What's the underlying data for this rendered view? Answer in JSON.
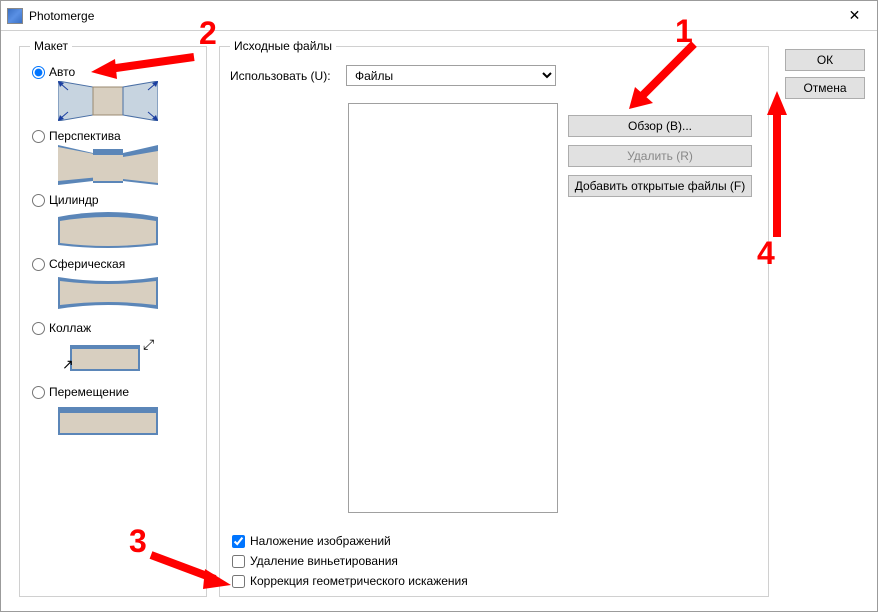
{
  "window": {
    "title": "Photomerge"
  },
  "layout": {
    "legend": "Макет",
    "options": [
      {
        "label": "Авто",
        "selected": true
      },
      {
        "label": "Перспектива",
        "selected": false
      },
      {
        "label": "Цилиндр",
        "selected": false
      },
      {
        "label": "Сферическая",
        "selected": false
      },
      {
        "label": "Коллаж",
        "selected": false
      },
      {
        "label": "Перемещение",
        "selected": false
      }
    ]
  },
  "source": {
    "legend": "Исходные файлы",
    "useLabel": "Использовать (U):",
    "useValue": "Файлы",
    "browse": "Обзор (B)...",
    "remove": "Удалить (R)",
    "addOpen": "Добавить открытые файлы (F)"
  },
  "checks": {
    "blend": {
      "label": "Наложение изображений",
      "checked": true
    },
    "vignette": {
      "label": "Удаление виньетирования",
      "checked": false
    },
    "distort": {
      "label": "Коррекция геометрического искажения",
      "checked": false
    }
  },
  "actions": {
    "ok": "ОК",
    "cancel": "Отмена"
  },
  "annotations": {
    "a1": "1",
    "a2": "2",
    "a3": "3",
    "a4": "4"
  }
}
